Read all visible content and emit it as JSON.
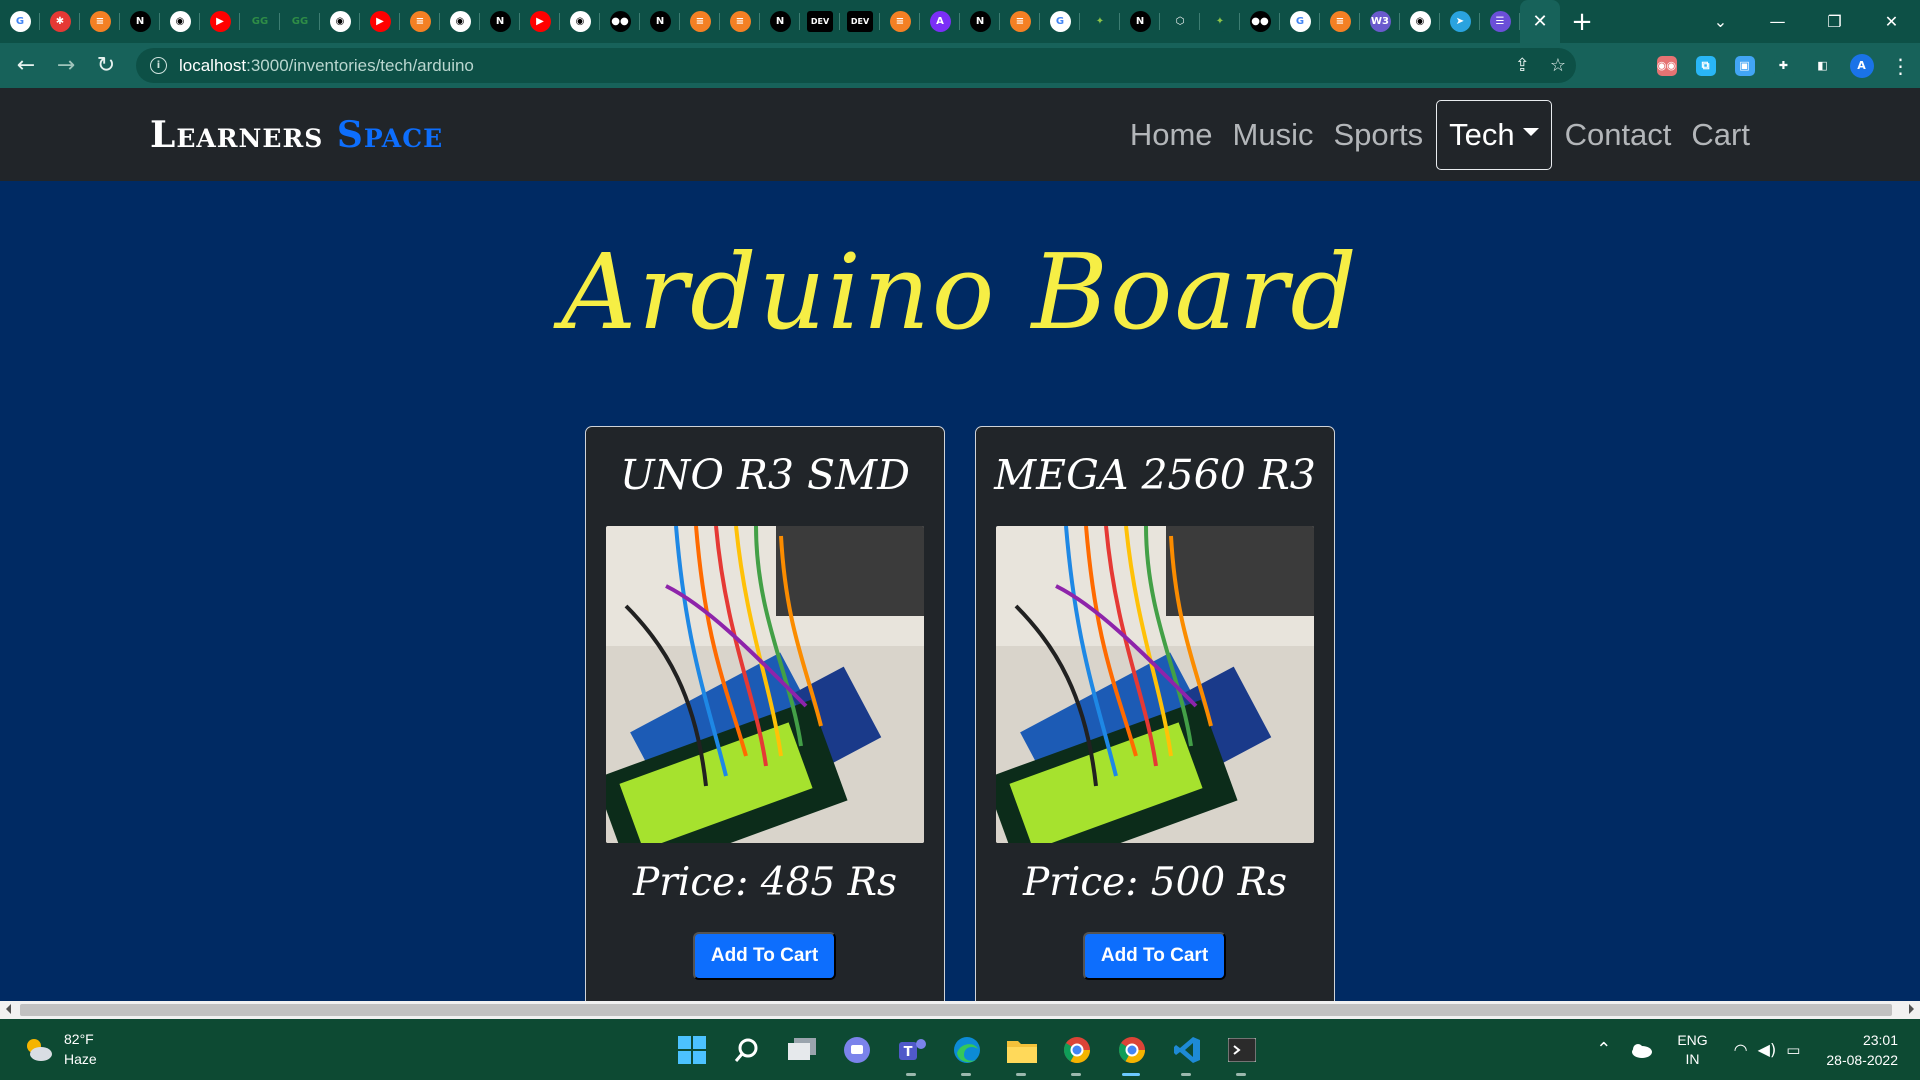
{
  "browser": {
    "tabs": [
      {
        "icon": "google-icon",
        "glyph": "G",
        "color": "#ffffff",
        "fg": "#4285f4"
      },
      {
        "icon": "settings-gear-icon",
        "glyph": "✱",
        "color": "#e53935",
        "fg": "#ffffff"
      },
      {
        "icon": "stackoverflow-icon",
        "glyph": "≡",
        "color": "#f48024",
        "fg": "#ffffff"
      },
      {
        "icon": "notion-icon",
        "glyph": "N",
        "color": "#000000",
        "fg": "#ffffff"
      },
      {
        "icon": "github-icon",
        "glyph": "◉",
        "color": "#ffffff",
        "fg": "#000000"
      },
      {
        "icon": "youtube-icon",
        "glyph": "▶",
        "color": "#ff0000",
        "fg": "#ffffff"
      },
      {
        "icon": "geeksforgeeks-icon",
        "glyph": "GG",
        "color": "#0d5046",
        "fg": "#2f8d46"
      },
      {
        "icon": "geeksforgeeks-icon",
        "glyph": "GG",
        "color": "#0d5046",
        "fg": "#2f8d46"
      },
      {
        "icon": "github-icon",
        "glyph": "◉",
        "color": "#ffffff",
        "fg": "#000000"
      },
      {
        "icon": "youtube-icon",
        "glyph": "▶",
        "color": "#ff0000",
        "fg": "#ffffff"
      },
      {
        "icon": "stackoverflow-icon",
        "glyph": "≡",
        "color": "#f48024",
        "fg": "#ffffff"
      },
      {
        "icon": "github-icon",
        "glyph": "◉",
        "color": "#ffffff",
        "fg": "#000000"
      },
      {
        "icon": "notion-icon",
        "glyph": "N",
        "color": "#000000",
        "fg": "#ffffff"
      },
      {
        "icon": "youtube-icon",
        "glyph": "▶",
        "color": "#ff0000",
        "fg": "#ffffff"
      },
      {
        "icon": "github-icon",
        "glyph": "◉",
        "color": "#ffffff",
        "fg": "#000000"
      },
      {
        "icon": "medium-icon",
        "glyph": "●●",
        "color": "#000000",
        "fg": "#ffffff"
      },
      {
        "icon": "notion-icon",
        "glyph": "N",
        "color": "#000000",
        "fg": "#ffffff"
      },
      {
        "icon": "stackoverflow-icon",
        "glyph": "≡",
        "color": "#f48024",
        "fg": "#ffffff"
      },
      {
        "icon": "stackoverflow-icon",
        "glyph": "≡",
        "color": "#f48024",
        "fg": "#ffffff"
      },
      {
        "icon": "notion-icon",
        "glyph": "N",
        "color": "#000000",
        "fg": "#ffffff"
      },
      {
        "icon": "dev-icon",
        "glyph": "DEV",
        "color": "#000000",
        "fg": "#ffffff"
      },
      {
        "icon": "dev-icon",
        "glyph": "DEV",
        "color": "#000000",
        "fg": "#ffffff"
      },
      {
        "icon": "stackoverflow-icon",
        "glyph": "≡",
        "color": "#f48024",
        "fg": "#ffffff"
      },
      {
        "icon": "app-icon",
        "glyph": "A",
        "color": "#7b2ff7",
        "fg": "#ffffff"
      },
      {
        "icon": "notion-icon",
        "glyph": "N",
        "color": "#000000",
        "fg": "#ffffff"
      },
      {
        "icon": "stackoverflow-icon",
        "glyph": "≡",
        "color": "#f48024",
        "fg": "#ffffff"
      },
      {
        "icon": "google-icon",
        "glyph": "G",
        "color": "#ffffff",
        "fg": "#4285f4"
      },
      {
        "icon": "sparkle-icon",
        "glyph": "✦",
        "color": "#0d5046",
        "fg": "#8bc34a"
      },
      {
        "icon": "notion-icon",
        "glyph": "N",
        "color": "#000000",
        "fg": "#ffffff"
      },
      {
        "icon": "cube-icon",
        "glyph": "⬡",
        "color": "#0d5046",
        "fg": "#ffffff"
      },
      {
        "icon": "sparkle-icon",
        "glyph": "✦",
        "color": "#0d5046",
        "fg": "#8bc34a"
      },
      {
        "icon": "medium-icon",
        "glyph": "●●",
        "color": "#000000",
        "fg": "#ffffff"
      },
      {
        "icon": "google-icon",
        "glyph": "G",
        "color": "#ffffff",
        "fg": "#4285f4"
      },
      {
        "icon": "stackoverflow-icon",
        "glyph": "≡",
        "color": "#f48024",
        "fg": "#ffffff"
      },
      {
        "icon": "w3schools-icon",
        "glyph": "W3",
        "color": "#6a5acd",
        "fg": "#ffffff"
      },
      {
        "icon": "github-icon",
        "glyph": "◉",
        "color": "#ffffff",
        "fg": "#000000"
      },
      {
        "icon": "telegram-icon",
        "glyph": "➤",
        "color": "#2aa3df",
        "fg": "#ffffff"
      },
      {
        "icon": "list-icon",
        "glyph": "☰",
        "color": "#6b4fd8",
        "fg": "#ffffff"
      }
    ],
    "active_tab_close": "✕",
    "new_tab": "+",
    "url_host": "localhost",
    "url_path": ":3000/inventories/tech/arduino",
    "profile_initial": "A",
    "extensions": [
      {
        "icon": "eyes-extension-icon",
        "glyph": "◉◉",
        "color": "#e57373"
      },
      {
        "icon": "clipboard-extension-icon",
        "glyph": "⧉",
        "color": "#29b6f6"
      },
      {
        "icon": "screen-extension-icon",
        "glyph": "▣",
        "color": "#42a5f5"
      },
      {
        "icon": "puzzle-extension-icon",
        "glyph": "✚",
        "color": "#17625a"
      },
      {
        "icon": "sidepanel-icon",
        "glyph": "◧",
        "color": "#17625a"
      }
    ]
  },
  "site": {
    "brand_part1": "Learners",
    "brand_part2": "Space",
    "nav": {
      "home": "Home",
      "music": "Music",
      "sports": "Sports",
      "tech": "Tech",
      "contact": "Contact",
      "cart": "Cart"
    },
    "heading": "Arduino Board",
    "products": [
      {
        "title": "UNO R3 SMD",
        "price": "Price: 485 Rs",
        "button": "Add To Cart"
      },
      {
        "title": "MEGA 2560 R3",
        "price": "Price: 500 Rs",
        "button": "Add To Cart"
      }
    ]
  },
  "taskbar": {
    "weather_temp": "82°F",
    "weather_desc": "Haze",
    "lang_1": "ENG",
    "lang_2": "IN",
    "time": "23:01",
    "date": "28-08-2022"
  }
}
